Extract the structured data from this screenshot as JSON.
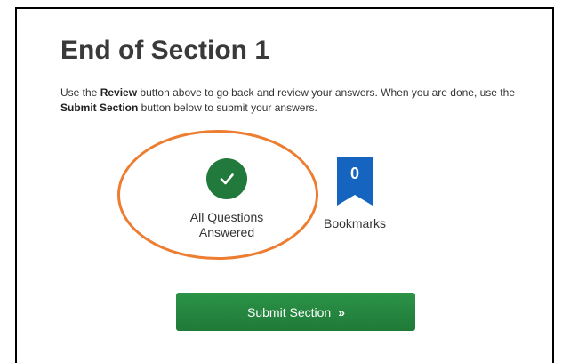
{
  "page": {
    "title": "End of Section 1",
    "instructions": {
      "part1": "Use the ",
      "review_label": "Review",
      "part2": " button above to go back and review your answers. When you are done, use the ",
      "submit_label": "Submit Section",
      "part3": " button below to submit your answers."
    }
  },
  "status": {
    "answered_label_line1": "All Questions",
    "answered_label_line2": "Answered",
    "icon": "check-icon",
    "color": "#217a3c"
  },
  "bookmarks": {
    "count": "0",
    "label": "Bookmarks",
    "icon": "bookmark-icon",
    "color": "#1565c0"
  },
  "annotation": {
    "color": "#ed7d31"
  },
  "submit": {
    "label": "Submit Section",
    "chevron": "»"
  }
}
